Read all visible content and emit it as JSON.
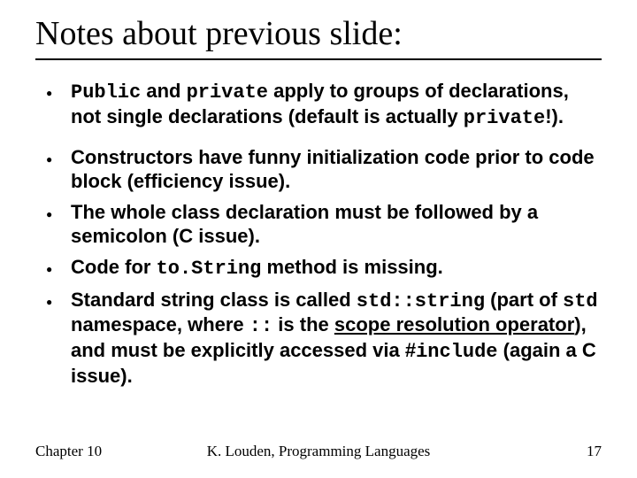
{
  "title": "Notes about previous slide:",
  "bullets": {
    "b1": {
      "code1": "Public",
      "t1": " and ",
      "code2": "private",
      "t2": " apply to groups of declarations, not single declarations (default is actually ",
      "code3": "private",
      "t3": "!)."
    },
    "b2": "Constructors have funny initialization code prior to code block (efficiency issue).",
    "b3": "The whole class declaration must be followed by a semicolon (C issue).",
    "b4": {
      "t1": "Code for ",
      "code1": "to.String",
      "t2": " method is missing."
    },
    "b5": {
      "t1": "Standard string class is called ",
      "code1": "std::string",
      "t2": " (part of ",
      "code2": "std",
      "t3": " namespace, where ",
      "code3": "::",
      "t4": " is the ",
      "u1": "scope resolution operator",
      "t5": "), and must be explicitly accessed via #",
      "code4": "include",
      "t6": " (again a C issue)."
    }
  },
  "footer": {
    "left": "Chapter 10",
    "center": "K. Louden, Programming Languages",
    "right": "17"
  }
}
